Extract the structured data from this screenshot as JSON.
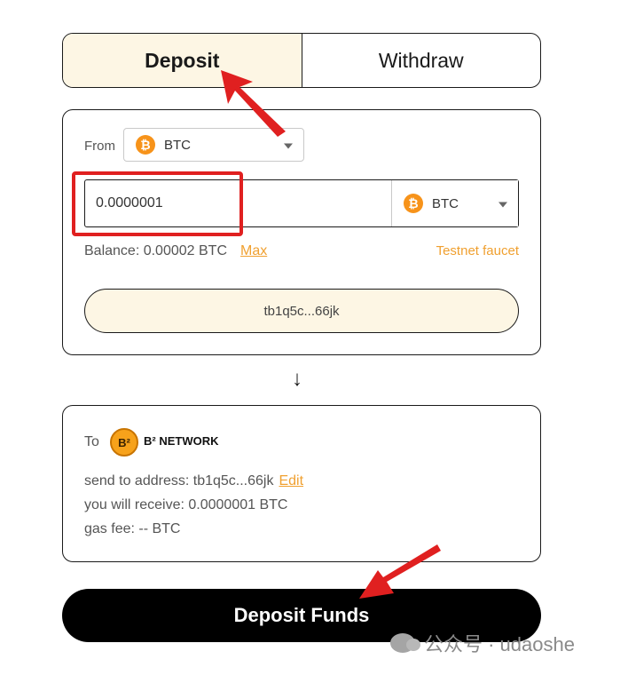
{
  "tabs": {
    "deposit": "Deposit",
    "withdraw": "Withdraw"
  },
  "from_card": {
    "label": "From",
    "chain_select": {
      "coin_symbol": "₿",
      "value": "BTC"
    },
    "amount": "0.0000001",
    "token_select": {
      "coin_symbol": "₿",
      "value": "BTC"
    },
    "balance": "Balance: 0.00002 BTC",
    "max_label": "Max",
    "faucet_label": "Testnet faucet",
    "wallet_address": "tb1q5c...66jk"
  },
  "flow_arrow": "↓",
  "to_card": {
    "label": "To",
    "network_logo": "B²",
    "network_name": "B² NETWORK",
    "send_to": "send to address: tb1q5c...66jk",
    "edit_label": "Edit",
    "receive": "you will receive: 0.0000001 BTC",
    "gas_fee": "gas fee: -- BTC"
  },
  "submit_label": "Deposit Funds",
  "watermark": "公众号 · udaoshe",
  "colors": {
    "accent": "#f0a030",
    "highlight_red": "#e02020",
    "cream": "#fdf6e4",
    "bitcoin_orange": "#f7931a"
  },
  "icons": {
    "coin": "bitcoin-icon",
    "dropdown": "chevron-down-icon",
    "arrow": "arrow-down-icon"
  }
}
